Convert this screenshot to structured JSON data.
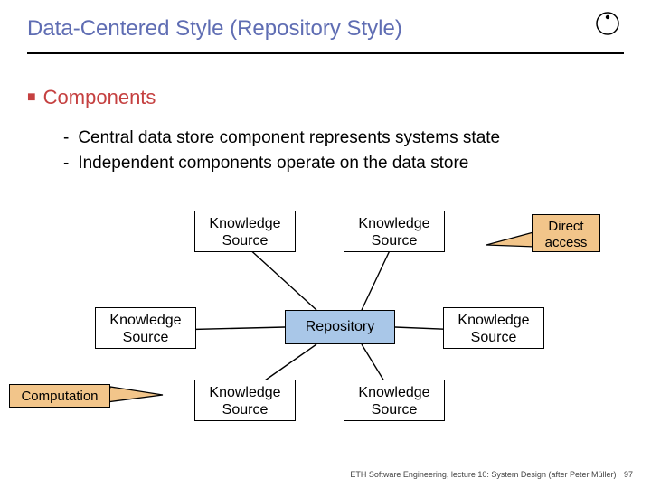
{
  "title": "Data-Centered Style (Repository Style)",
  "section_heading": "Components",
  "sub_points": {
    "a": "Central data store component represents systems state",
    "b": "Independent components operate on the data store"
  },
  "diagram": {
    "ks_label": "Knowledge Source",
    "ks_line1": "Knowledge",
    "ks_line2": "Source",
    "repo_label": "Repository",
    "callout_direct_line1": "Direct",
    "callout_direct_line2": "access",
    "callout_computation": "Computation"
  },
  "footer": {
    "text": "ETH Software Engineering, lecture 10: System Design (after Peter Müller)",
    "page": "97"
  }
}
